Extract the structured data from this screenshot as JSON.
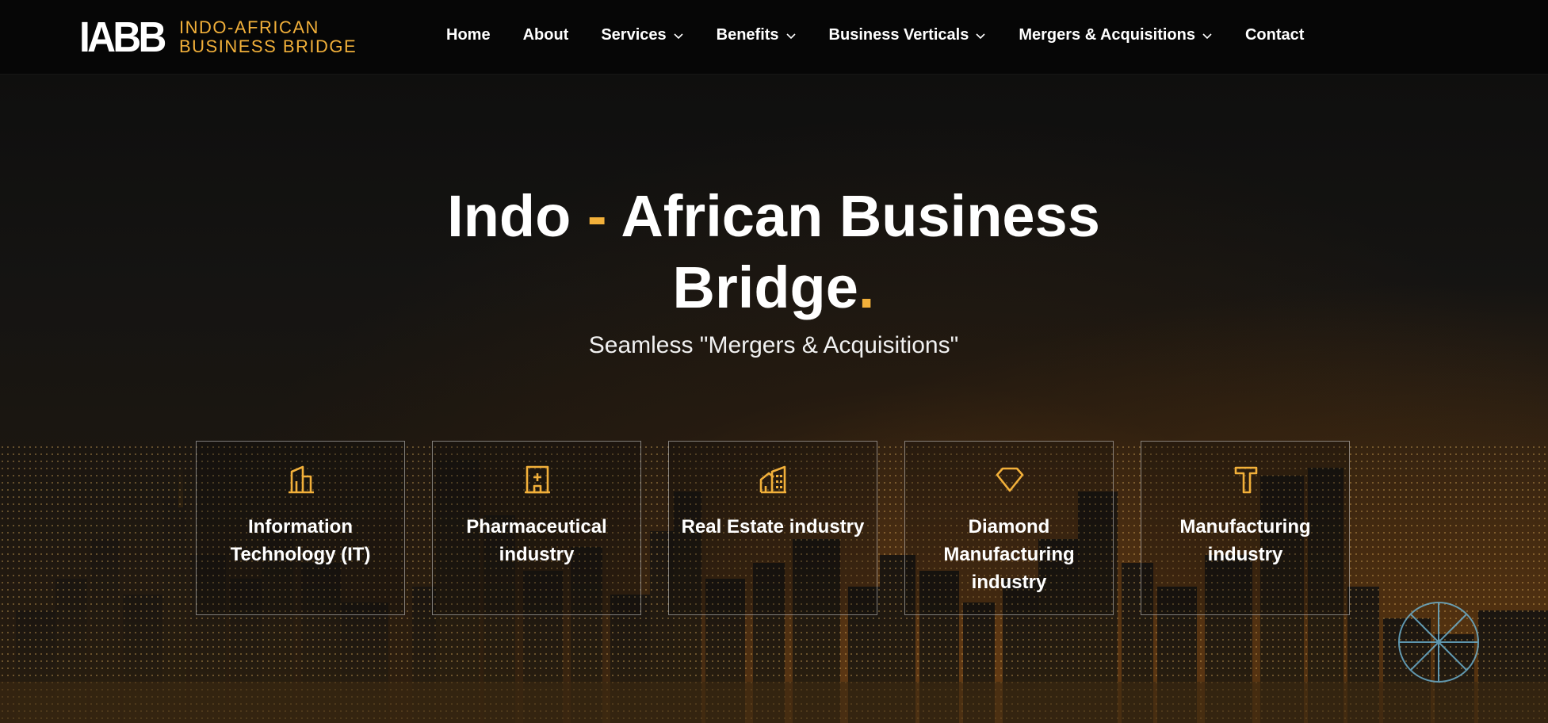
{
  "header": {
    "logo_mark": "IABB",
    "logo_line1": "INDO-AFRICAN",
    "logo_line2": "BUSINESS BRIDGE"
  },
  "nav": [
    {
      "label": "Home",
      "has_dropdown": false
    },
    {
      "label": "About",
      "has_dropdown": false
    },
    {
      "label": "Services",
      "has_dropdown": true
    },
    {
      "label": "Benefits",
      "has_dropdown": true
    },
    {
      "label": "Business Verticals",
      "has_dropdown": true
    },
    {
      "label": "Mergers & Acquisitions",
      "has_dropdown": true
    },
    {
      "label": "Contact",
      "has_dropdown": false
    }
  ],
  "hero": {
    "title_part1": "Indo",
    "title_dash": "-",
    "title_part2": "African Business",
    "title_part3": "Bridge",
    "title_dot": ".",
    "subtitle": "Seamless \"Mergers & Acquisitions\""
  },
  "cards": [
    {
      "line1": "Information",
      "line2": "Technology (IT)",
      "line3": "",
      "icon": "building-icon"
    },
    {
      "line1": "Pharmaceutical",
      "line2": "industry",
      "line3": "",
      "icon": "hospital-icon"
    },
    {
      "line1": "Real Estate industry",
      "line2": "",
      "line3": "",
      "icon": "buildings-icon"
    },
    {
      "line1": "Diamond",
      "line2": "Manufacturing",
      "line3": "industry",
      "icon": "diamond-icon"
    },
    {
      "line1": "Manufacturing",
      "line2": "industry",
      "line3": "",
      "icon": "hammer-icon"
    }
  ],
  "colors": {
    "accent": "#f2b03a",
    "header_bg": "#060606",
    "text": "#ffffff"
  }
}
